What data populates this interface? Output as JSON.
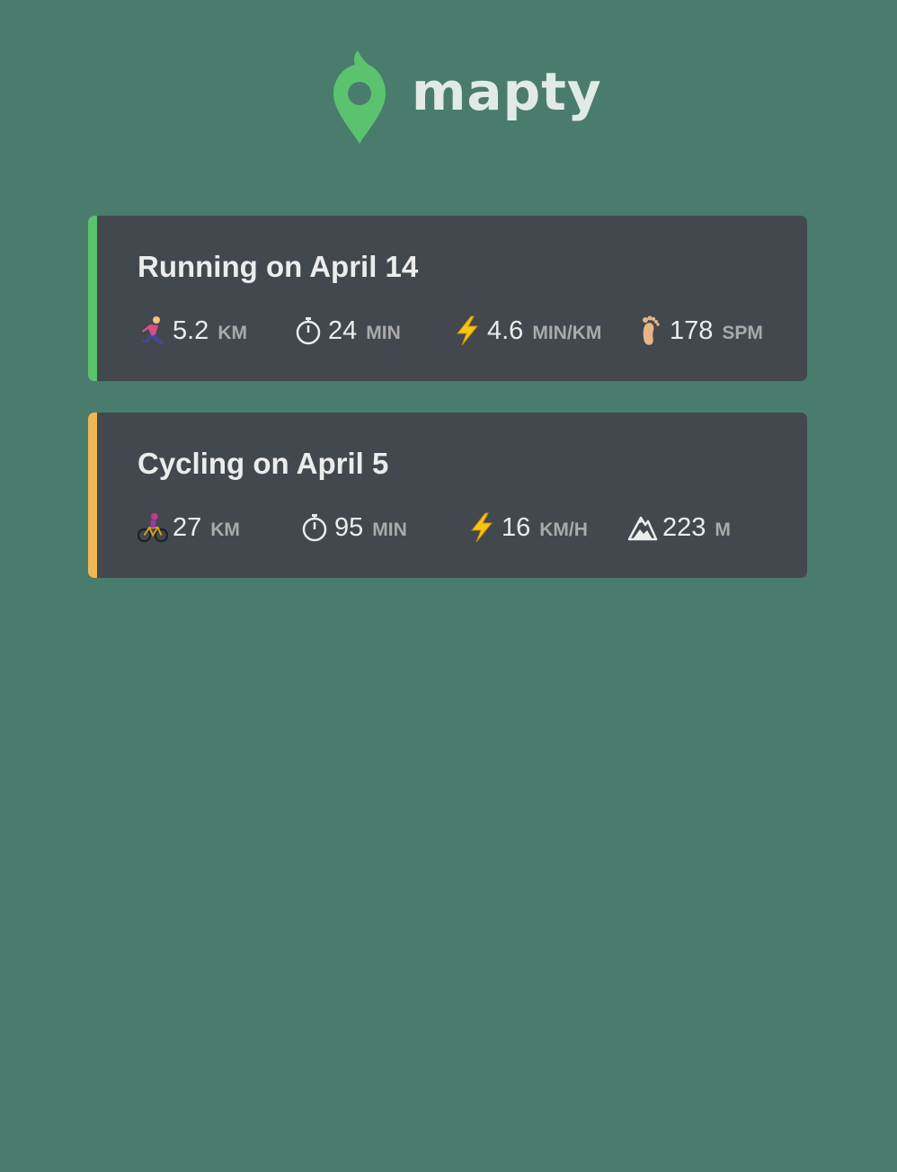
{
  "app": {
    "name": "mapty"
  },
  "workouts": [
    {
      "type": "running",
      "title": "Running on April 14",
      "accent_color": "#5bc36e",
      "stats": [
        {
          "icon": "runner-icon",
          "value": "5.2",
          "unit": "KM"
        },
        {
          "icon": "stopwatch-icon",
          "value": "24",
          "unit": "MIN"
        },
        {
          "icon": "lightning-icon",
          "value": "4.6",
          "unit": "MIN/KM"
        },
        {
          "icon": "foot-icon",
          "value": "178",
          "unit": "SPM"
        }
      ]
    },
    {
      "type": "cycling",
      "title": "Cycling on April 5",
      "accent_color": "#f0b655",
      "stats": [
        {
          "icon": "cyclist-icon",
          "value": "27",
          "unit": "KM"
        },
        {
          "icon": "stopwatch-icon",
          "value": "95",
          "unit": "MIN"
        },
        {
          "icon": "lightning-icon",
          "value": "16",
          "unit": "KM/H"
        },
        {
          "icon": "mountain-icon",
          "value": "223",
          "unit": "M"
        }
      ]
    }
  ]
}
